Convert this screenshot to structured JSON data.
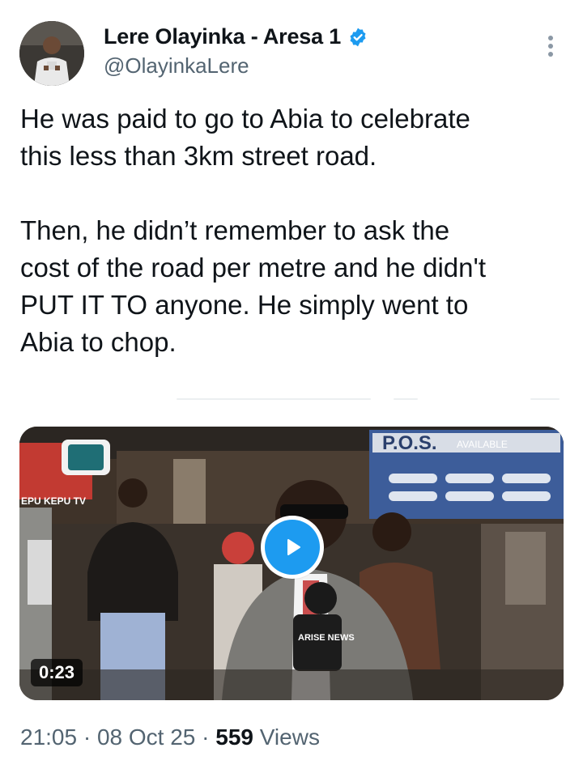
{
  "author": {
    "display_name": "Lere Olayinka - Aresa 1",
    "handle": "@OlayinkaLere",
    "verified": true,
    "avatar_icon": "profile-avatar"
  },
  "more_menu_icon": "more-vertical-icon",
  "tweet": {
    "paragraph1": [
      "He was paid to go to Abia to celebrate",
      "this less than 3km street road."
    ],
    "paragraph2": [
      "Then, he didn’t remember to ask the",
      "cost of the road per metre and he didn't",
      "PUT IT TO anyone. He simply went to",
      "Abia to chop."
    ]
  },
  "video": {
    "duration": "0:23",
    "play_icon": "play-icon",
    "sign_text": "P.O.S.",
    "sign_subtext": "AVAILABLE",
    "logo_text": "EPU KEPU TV",
    "mic_text": "ARISE NEWS"
  },
  "meta": {
    "time": "21:05",
    "separator": "·",
    "date": "08 Oct 25",
    "views_count": "559",
    "views_label": "Views"
  },
  "colors": {
    "accent": "#1d9bf0",
    "text_primary": "#0f1419",
    "text_secondary": "#536471"
  }
}
